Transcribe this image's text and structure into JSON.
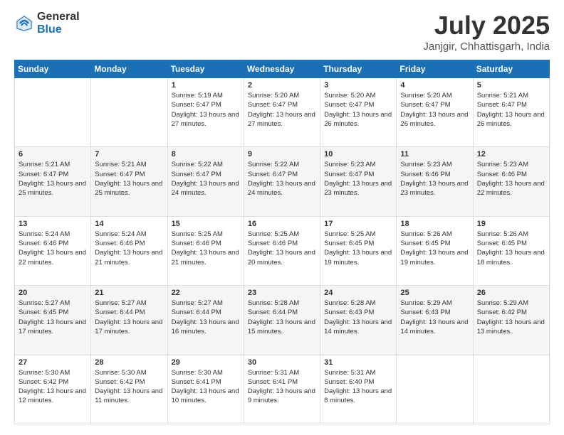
{
  "logo": {
    "general": "General",
    "blue": "Blue"
  },
  "header": {
    "title": "July 2025",
    "subtitle": "Janjgir, Chhattisgarh, India"
  },
  "days_of_week": [
    "Sunday",
    "Monday",
    "Tuesday",
    "Wednesday",
    "Thursday",
    "Friday",
    "Saturday"
  ],
  "weeks": [
    [
      {
        "day": "",
        "info": ""
      },
      {
        "day": "",
        "info": ""
      },
      {
        "day": "1",
        "info": "Sunrise: 5:19 AM\nSunset: 6:47 PM\nDaylight: 13 hours and 27 minutes."
      },
      {
        "day": "2",
        "info": "Sunrise: 5:20 AM\nSunset: 6:47 PM\nDaylight: 13 hours and 27 minutes."
      },
      {
        "day": "3",
        "info": "Sunrise: 5:20 AM\nSunset: 6:47 PM\nDaylight: 13 hours and 26 minutes."
      },
      {
        "day": "4",
        "info": "Sunrise: 5:20 AM\nSunset: 6:47 PM\nDaylight: 13 hours and 26 minutes."
      },
      {
        "day": "5",
        "info": "Sunrise: 5:21 AM\nSunset: 6:47 PM\nDaylight: 13 hours and 26 minutes."
      }
    ],
    [
      {
        "day": "6",
        "info": "Sunrise: 5:21 AM\nSunset: 6:47 PM\nDaylight: 13 hours and 25 minutes."
      },
      {
        "day": "7",
        "info": "Sunrise: 5:21 AM\nSunset: 6:47 PM\nDaylight: 13 hours and 25 minutes."
      },
      {
        "day": "8",
        "info": "Sunrise: 5:22 AM\nSunset: 6:47 PM\nDaylight: 13 hours and 24 minutes."
      },
      {
        "day": "9",
        "info": "Sunrise: 5:22 AM\nSunset: 6:47 PM\nDaylight: 13 hours and 24 minutes."
      },
      {
        "day": "10",
        "info": "Sunrise: 5:23 AM\nSunset: 6:47 PM\nDaylight: 13 hours and 23 minutes."
      },
      {
        "day": "11",
        "info": "Sunrise: 5:23 AM\nSunset: 6:46 PM\nDaylight: 13 hours and 23 minutes."
      },
      {
        "day": "12",
        "info": "Sunrise: 5:23 AM\nSunset: 6:46 PM\nDaylight: 13 hours and 22 minutes."
      }
    ],
    [
      {
        "day": "13",
        "info": "Sunrise: 5:24 AM\nSunset: 6:46 PM\nDaylight: 13 hours and 22 minutes."
      },
      {
        "day": "14",
        "info": "Sunrise: 5:24 AM\nSunset: 6:46 PM\nDaylight: 13 hours and 21 minutes."
      },
      {
        "day": "15",
        "info": "Sunrise: 5:25 AM\nSunset: 6:46 PM\nDaylight: 13 hours and 21 minutes."
      },
      {
        "day": "16",
        "info": "Sunrise: 5:25 AM\nSunset: 6:46 PM\nDaylight: 13 hours and 20 minutes."
      },
      {
        "day": "17",
        "info": "Sunrise: 5:25 AM\nSunset: 6:45 PM\nDaylight: 13 hours and 19 minutes."
      },
      {
        "day": "18",
        "info": "Sunrise: 5:26 AM\nSunset: 6:45 PM\nDaylight: 13 hours and 19 minutes."
      },
      {
        "day": "19",
        "info": "Sunrise: 5:26 AM\nSunset: 6:45 PM\nDaylight: 13 hours and 18 minutes."
      }
    ],
    [
      {
        "day": "20",
        "info": "Sunrise: 5:27 AM\nSunset: 6:45 PM\nDaylight: 13 hours and 17 minutes."
      },
      {
        "day": "21",
        "info": "Sunrise: 5:27 AM\nSunset: 6:44 PM\nDaylight: 13 hours and 17 minutes."
      },
      {
        "day": "22",
        "info": "Sunrise: 5:27 AM\nSunset: 6:44 PM\nDaylight: 13 hours and 16 minutes."
      },
      {
        "day": "23",
        "info": "Sunrise: 5:28 AM\nSunset: 6:44 PM\nDaylight: 13 hours and 15 minutes."
      },
      {
        "day": "24",
        "info": "Sunrise: 5:28 AM\nSunset: 6:43 PM\nDaylight: 13 hours and 14 minutes."
      },
      {
        "day": "25",
        "info": "Sunrise: 5:29 AM\nSunset: 6:43 PM\nDaylight: 13 hours and 14 minutes."
      },
      {
        "day": "26",
        "info": "Sunrise: 5:29 AM\nSunset: 6:42 PM\nDaylight: 13 hours and 13 minutes."
      }
    ],
    [
      {
        "day": "27",
        "info": "Sunrise: 5:30 AM\nSunset: 6:42 PM\nDaylight: 13 hours and 12 minutes."
      },
      {
        "day": "28",
        "info": "Sunrise: 5:30 AM\nSunset: 6:42 PM\nDaylight: 13 hours and 11 minutes."
      },
      {
        "day": "29",
        "info": "Sunrise: 5:30 AM\nSunset: 6:41 PM\nDaylight: 13 hours and 10 minutes."
      },
      {
        "day": "30",
        "info": "Sunrise: 5:31 AM\nSunset: 6:41 PM\nDaylight: 13 hours and 9 minutes."
      },
      {
        "day": "31",
        "info": "Sunrise: 5:31 AM\nSunset: 6:40 PM\nDaylight: 13 hours and 8 minutes."
      },
      {
        "day": "",
        "info": ""
      },
      {
        "day": "",
        "info": ""
      }
    ]
  ]
}
